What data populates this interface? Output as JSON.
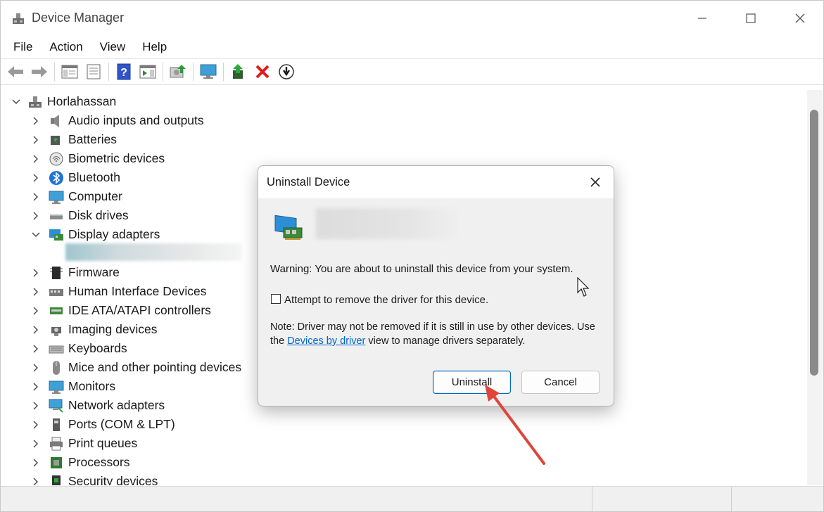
{
  "window": {
    "title": "Device Manager",
    "controls": {
      "minimize": "—",
      "maximize": "☐",
      "close": "✕"
    }
  },
  "menu": [
    "File",
    "Action",
    "View",
    "Help"
  ],
  "toolbar": {
    "buttons": [
      "back-arrow-icon",
      "forward-arrow-icon",
      "show-hide-console-tree-icon",
      "properties-icon",
      "help-icon",
      "action-pane-icon",
      "scan-hardware-icon",
      "monitor-icon",
      "update-driver-icon",
      "uninstall-icon",
      "disable-device-icon"
    ]
  },
  "tree": {
    "root": "Horlahassan",
    "items": [
      "Audio inputs and outputs",
      "Batteries",
      "Biometric devices",
      "Bluetooth",
      "Computer",
      "Disk drives",
      "Display adapters",
      "Firmware",
      "Human Interface Devices",
      "IDE ATA/ATAPI controllers",
      "Imaging devices",
      "Keyboards",
      "Mice and other pointing devices",
      "Monitors",
      "Network adapters",
      "Ports (COM & LPT)",
      "Print queues",
      "Processors",
      "Security devices"
    ]
  },
  "dialog": {
    "title": "Uninstall Device",
    "close": "✕",
    "warning": "Warning: You are about to uninstall this device from your system.",
    "checkbox_label": "Attempt to remove the driver for this device.",
    "checkbox_checked": false,
    "note_before": "Note: Driver may not be removed if it is still in use by other devices. Use the ",
    "note_link": "Devices by driver",
    "note_after": " view to manage drivers separately.",
    "uninstall_label": "Uninstall",
    "cancel_label": "Cancel"
  },
  "colors": {
    "accent": "#0067c0",
    "link": "#0066cc",
    "annotation_arrow": "#e0453c"
  }
}
